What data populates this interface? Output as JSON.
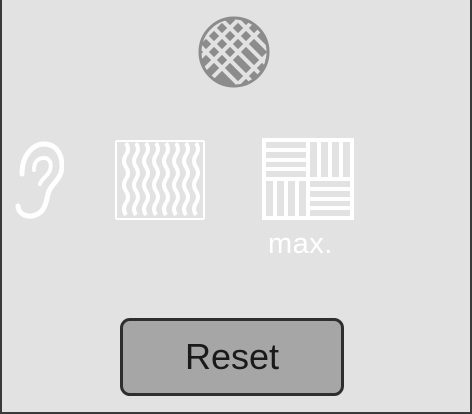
{
  "icons": {
    "top": "mesh-circle-icon",
    "left": "ear-icon",
    "middle": "wavy-lines-icon",
    "right": "parquet-icon"
  },
  "labels": {
    "max": "max."
  },
  "buttons": {
    "reset": "Reset"
  },
  "colors": {
    "screen_background": "#e2e2e2",
    "icon_white": "#ffffff",
    "mesh_grey": "#8c8c8c",
    "button_fill": "#a6a6a6",
    "button_border": "#2e2e2e"
  }
}
